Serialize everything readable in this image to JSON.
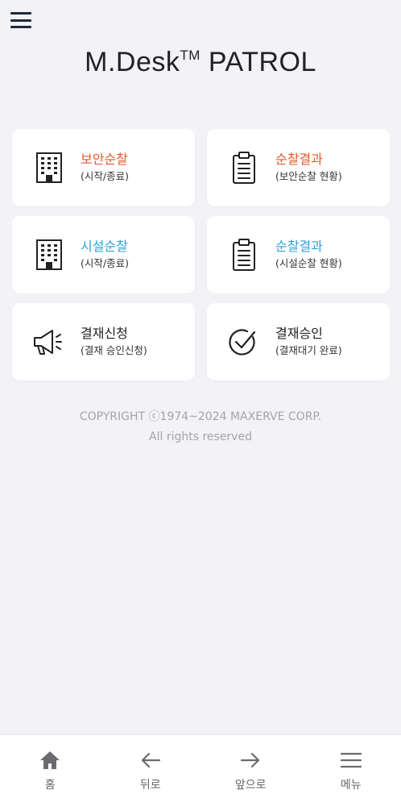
{
  "header": {
    "title_main": "M.Desk",
    "title_tm": "TM",
    "title_suffix": " PATROL"
  },
  "menu": {
    "security_patrol": {
      "title": "보안순찰",
      "subtitle": "(시작/종료)",
      "color": "#e8572a",
      "icon": "building-icon"
    },
    "security_result": {
      "title": "순찰결과",
      "subtitle": "(보안순찰 현황)",
      "color": "#e8572a",
      "icon": "clipboard-icon"
    },
    "facility_patrol": {
      "title": "시설순찰",
      "subtitle": "(시작/종료)",
      "color": "#2ba3dd",
      "icon": "building-icon"
    },
    "facility_result": {
      "title": "순찰결과",
      "subtitle": "(시설순찰 현황)",
      "color": "#2ba3dd",
      "icon": "clipboard-icon"
    },
    "approval_request": {
      "title": "결재신청",
      "subtitle": "(결재 승인신청)",
      "color": "#222222",
      "icon": "megaphone-icon"
    },
    "approval_confirm": {
      "title": "결재승인",
      "subtitle": "(결재대기 완료)",
      "color": "#222222",
      "icon": "check-circle-icon"
    }
  },
  "footer": {
    "copyright": "COPYRIGHT ⓒ1974~2024 MAXERVE CORP.",
    "rights": "All rights reserved"
  },
  "bottom_nav": {
    "home": "홈",
    "back": "뒤로",
    "forward": "앞으로",
    "menu": "메뉴"
  }
}
